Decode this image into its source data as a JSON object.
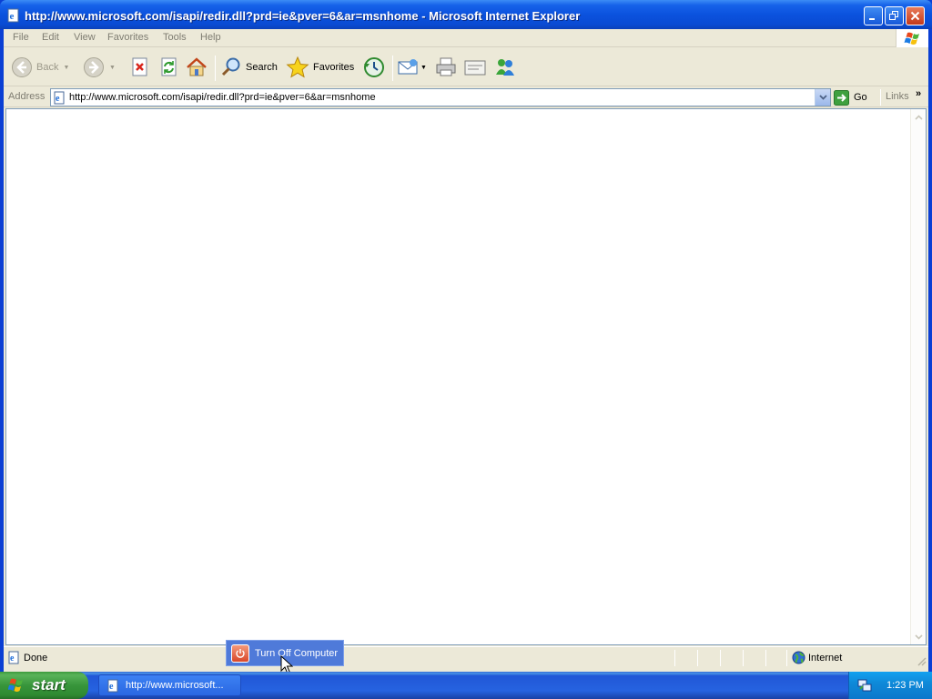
{
  "window": {
    "title": "http://www.microsoft.com/isapi/redir.dll?prd=ie&pver=6&ar=msnhome - Microsoft Internet Explorer"
  },
  "menu": {
    "items": [
      "File",
      "Edit",
      "View",
      "Favorites",
      "Tools",
      "Help"
    ]
  },
  "toolbar": {
    "back_label": "Back",
    "search_label": "Search",
    "favorites_label": "Favorites"
  },
  "address": {
    "label": "Address",
    "url": "http://www.microsoft.com/isapi/redir.dll?prd=ie&pver=6&ar=msnhome",
    "go_label": "Go",
    "links_label": "Links",
    "links_chevron": "»"
  },
  "status": {
    "text": "Done",
    "zone": "Internet"
  },
  "turnoff": {
    "label": "Turn Off Computer"
  },
  "taskbar": {
    "start_label": "start",
    "task_label": "http://www.microsoft...",
    "clock": "1:23 PM"
  },
  "colors": {
    "titlebar": "#0b52de",
    "start_button": "#37953b",
    "taskbar": "#2663e0",
    "chrome": "#ece9d8"
  },
  "icons": [
    "ie-page-icon",
    "minimize-icon",
    "maximize-icon",
    "close-icon",
    "windows-logo-icon",
    "back-icon",
    "forward-icon",
    "stop-icon",
    "refresh-icon",
    "home-icon",
    "search-icon",
    "favorites-star-icon",
    "history-icon",
    "mail-icon",
    "print-icon",
    "edit-icon",
    "messenger-icon",
    "go-arrow-icon",
    "globe-icon",
    "power-icon",
    "windows-flag-icon",
    "network-icon"
  ]
}
